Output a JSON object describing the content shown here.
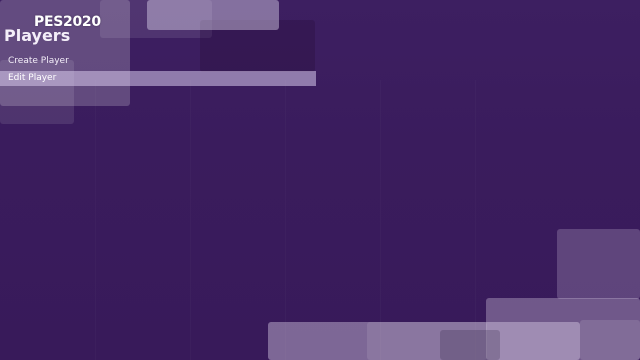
{
  "logo": {
    "text": "PES2020"
  },
  "menu": {
    "title": "Players",
    "items": [
      {
        "label": "Create Player",
        "selected": false
      },
      {
        "label": "Edit Player",
        "selected": true
      }
    ]
  },
  "colors": {
    "background": "#3b1d5e",
    "selection": "#c9b8e3"
  }
}
